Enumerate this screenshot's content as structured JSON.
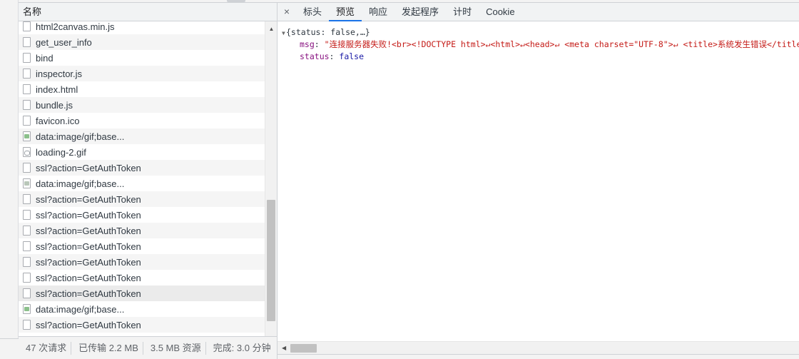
{
  "list": {
    "column_header": "名称",
    "rows": [
      {
        "name": "html2canvas.min.js",
        "icon": "file-icon"
      },
      {
        "name": "get_user_info",
        "icon": "file-icon"
      },
      {
        "name": "bind",
        "icon": "file-icon"
      },
      {
        "name": "inspector.js",
        "icon": "file-icon"
      },
      {
        "name": "index.html",
        "icon": "file-icon"
      },
      {
        "name": "bundle.js",
        "icon": "file-icon"
      },
      {
        "name": "favicon.ico",
        "icon": "file-icon"
      },
      {
        "name": "data:image/gif;base...",
        "icon": "image-icon"
      },
      {
        "name": "loading-2.gif",
        "icon": "gif-icon"
      },
      {
        "name": "ssl?action=GetAuthToken",
        "icon": "file-icon"
      },
      {
        "name": "data:image/gif;base...",
        "icon": "image-icon-gray"
      },
      {
        "name": "ssl?action=GetAuthToken",
        "icon": "file-icon"
      },
      {
        "name": "ssl?action=GetAuthToken",
        "icon": "file-icon"
      },
      {
        "name": "ssl?action=GetAuthToken",
        "icon": "file-icon"
      },
      {
        "name": "ssl?action=GetAuthToken",
        "icon": "file-icon"
      },
      {
        "name": "ssl?action=GetAuthToken",
        "icon": "file-icon"
      },
      {
        "name": "ssl?action=GetAuthToken",
        "icon": "file-icon"
      },
      {
        "name": "ssl?action=GetAuthToken",
        "icon": "file-icon",
        "selected": true
      },
      {
        "name": "data:image/gif;base...",
        "icon": "image-icon"
      },
      {
        "name": "ssl?action=GetAuthToken",
        "icon": "file-icon"
      }
    ]
  },
  "status_bar": {
    "requests": "47 次请求",
    "transferred": "已传输 2.2 MB",
    "resources": "3.5 MB 资源",
    "finish": "完成: 3.0 分钟"
  },
  "tabs": {
    "close": "×",
    "items": [
      "标头",
      "预览",
      "响应",
      "发起程序",
      "计时",
      "Cookie"
    ],
    "active": "预览"
  },
  "preview": {
    "summary": "{status: false,…}",
    "msg_key": "msg",
    "msg_value": "\"连接服务器失败!<br><!DOCTYPE html>↵<html>↵<head>↵    <meta charset=\"UTF-8\">↵    <title>系统发生错误</title>",
    "status_key": "status",
    "status_value": "false"
  },
  "icons": {
    "expand": "triangle-down-icon",
    "scroll_up": "scroll-up-arrow-icon",
    "scroll_left": "scroll-left-arrow-icon"
  },
  "colors": {
    "accent": "#1a73e8",
    "json_key": "#881280",
    "json_string": "#c41a16",
    "json_bool": "#1a1aa6"
  }
}
